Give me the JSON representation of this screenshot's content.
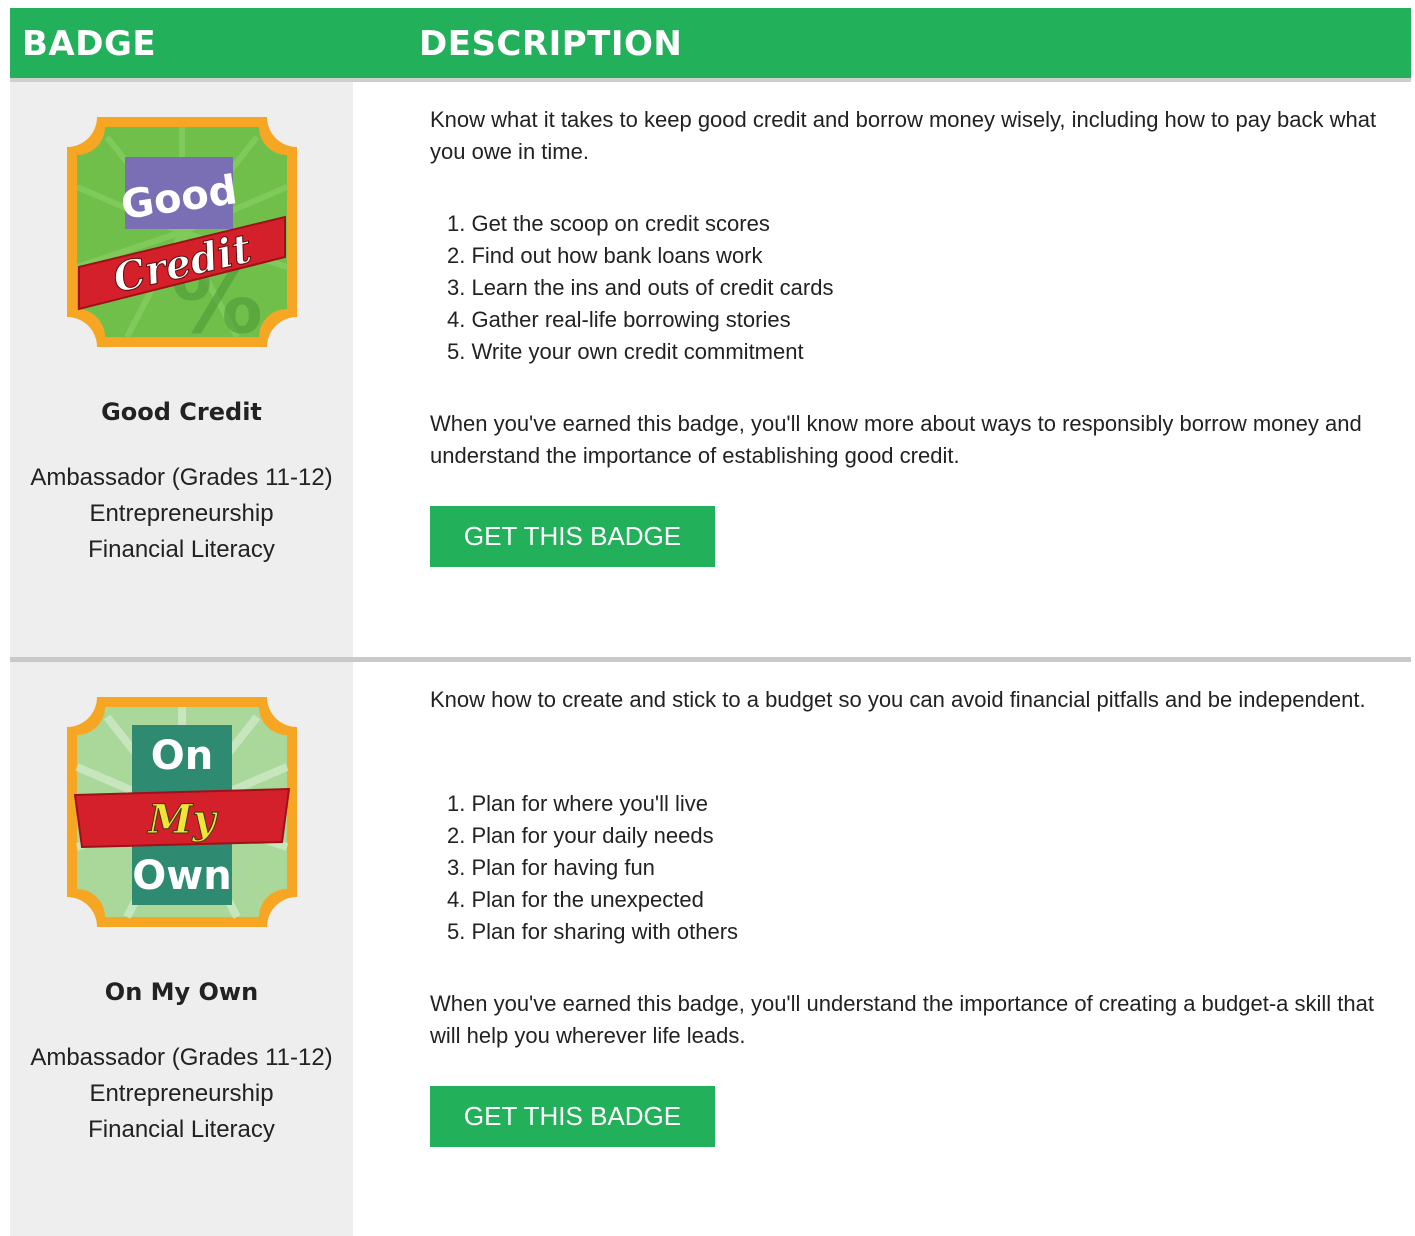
{
  "header": {
    "badge_col": "BADGE",
    "description_col": "DESCRIPTION"
  },
  "colors": {
    "accent_green": "#23b05a",
    "left_panel": "#eeeeee"
  },
  "badges": [
    {
      "art_text": [
        "Good",
        "Credit",
        "%"
      ],
      "name": "Good Credit",
      "level": "Ambassador (Grades 11-12)",
      "category_1": "Entrepreneurship",
      "category_2": "Financial Literacy",
      "intro": "Know what it takes to keep good credit and borrow money wisely, including how to pay back what you owe in time.",
      "steps": [
        "1. Get the scoop on credit scores",
        "2. Find out how bank loans work",
        "3. Learn the ins and outs of credit cards",
        "4. Gather real-life borrowing stories",
        "5. Write your own credit commitment"
      ],
      "outro": "When you've earned this badge, you'll know more about ways to responsibly borrow money and understand the importance of establishing good credit.",
      "button_label": "GET THIS BADGE"
    },
    {
      "art_text": [
        "On",
        "My",
        "Own"
      ],
      "name": "On My Own",
      "level": "Ambassador (Grades 11-12)",
      "category_1": "Entrepreneurship",
      "category_2": "Financial Literacy",
      "intro": "Know how to create and stick to a budget so you can avoid financial pitfalls and be independent.",
      "steps": [
        "1. Plan for where you'll live",
        "2. Plan for your daily needs",
        "3. Plan for having fun",
        "4. Plan for the unexpected",
        "5. Plan for sharing with others"
      ],
      "outro": "When you've earned this badge, you'll understand the importance of creating a budget-a skill that will help you wherever life leads.",
      "button_label": "GET THIS BADGE"
    }
  ]
}
